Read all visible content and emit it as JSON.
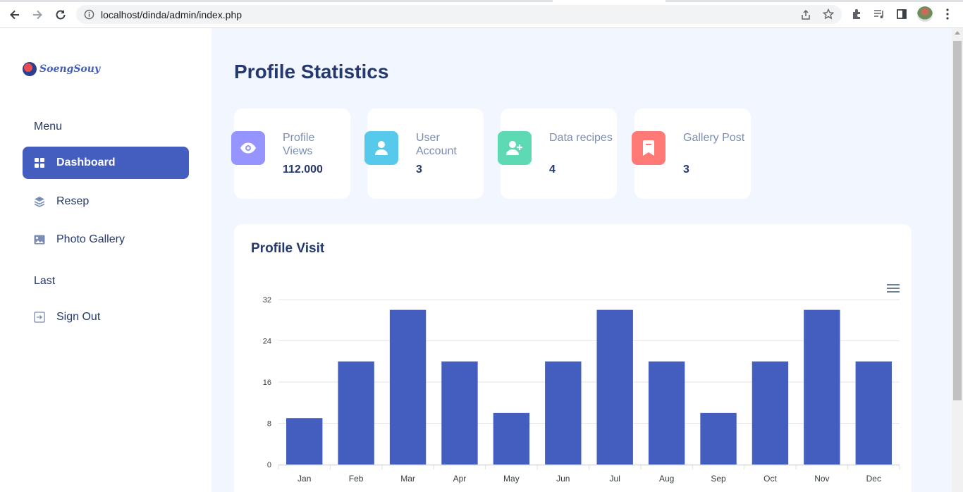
{
  "browser": {
    "url": "localhost/dinda/admin/index.php"
  },
  "sidebar": {
    "logo_text": "SoengSouy",
    "menu_title": "Menu",
    "last_title": "Last",
    "items": [
      {
        "label": "Dashboard",
        "icon": "grid-icon",
        "active": true
      },
      {
        "label": "Resep",
        "icon": "stack-icon",
        "active": false
      },
      {
        "label": "Photo Gallery",
        "icon": "image-icon",
        "active": false
      }
    ],
    "sign_out": {
      "label": "Sign Out",
      "icon": "sign-out-icon"
    }
  },
  "main": {
    "title": "Profile Statistics",
    "stats": [
      {
        "label": "Profile Views",
        "value": "112.000",
        "icon": "eye-icon",
        "color": "#9694ff"
      },
      {
        "label": "User Account",
        "value": "3",
        "icon": "user-icon",
        "color": "#57caeb"
      },
      {
        "label": "Data recipes",
        "value": "4",
        "icon": "user-plus-icon",
        "color": "#5ddab4"
      },
      {
        "label": "Gallery Post",
        "value": "3",
        "icon": "bookmark-icon",
        "color": "#ff7976"
      }
    ],
    "chart_title": "Profile Visit"
  },
  "colors": {
    "accent": "#435ebe",
    "text": "#25396f",
    "muted": "#7c8db5",
    "background": "#f2f7ff"
  },
  "chart_data": {
    "type": "bar",
    "categories": [
      "Jan",
      "Feb",
      "Mar",
      "Apr",
      "May",
      "Jun",
      "Jul",
      "Aug",
      "Sep",
      "Oct",
      "Nov",
      "Dec"
    ],
    "values": [
      9,
      20,
      30,
      20,
      10,
      20,
      30,
      20,
      10,
      20,
      30,
      20
    ],
    "title": "Profile Visit",
    "xlabel": "",
    "ylabel": "",
    "ylim": [
      0,
      32
    ],
    "yticks": [
      0,
      8,
      16,
      24,
      32
    ],
    "grid": true,
    "color": "#435ebe"
  }
}
